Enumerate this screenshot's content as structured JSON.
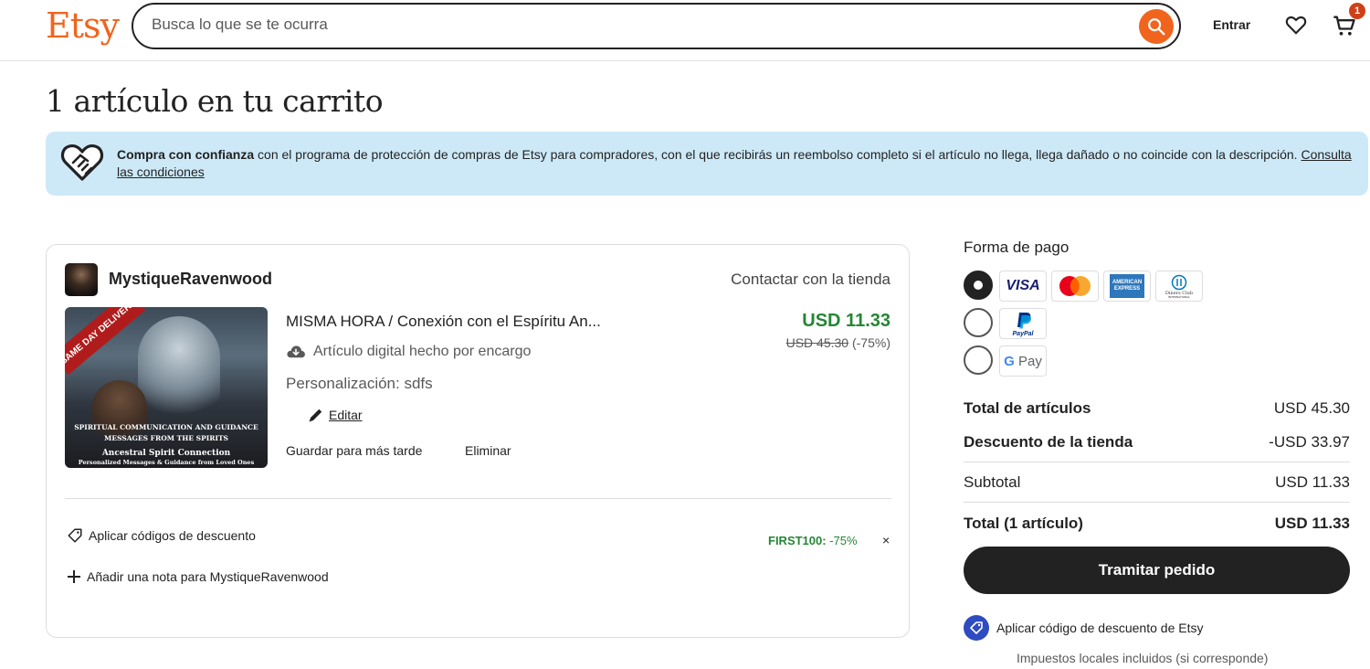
{
  "header": {
    "logo": "Etsy",
    "search_placeholder": "Busca lo que se te ocurra",
    "signin": "Entrar",
    "cart_count": "1"
  },
  "page": {
    "title": "1 artículo en tu carrito"
  },
  "banner": {
    "bold": "Compra con confianza",
    "text": " con el programa de protección de compras de Etsy para compradores, con el que recibirás un reembolso completo si el artículo no llega, llega dañado o no coincide con la descripción. ",
    "link": "Consulta las condiciones"
  },
  "shop": {
    "name": "MystiqueRavenwood",
    "contact": "Contactar con la tienda"
  },
  "item": {
    "image_ribbon": "SAME DAY DELIVERY",
    "image_caption_1": "SPIRITUAL COMMUNICATION AND GUIDANCE",
    "image_caption_2": "MESSAGES FROM THE SPIRITS",
    "image_caption_3": "Ancestral Spirit Connection",
    "image_caption_4": "Personalized Messages & Guidance from Loved Ones",
    "title": "MISMA HORA / Conexión con el Espíritu An...",
    "price": "USD 11.33",
    "original_price": "USD 45.30",
    "discount": "(-75%)",
    "type": "Artículo digital hecho por encargo",
    "personalization": "Personalización: sdfs",
    "edit": "Editar",
    "save_later": "Guardar para más tarde",
    "remove": "Eliminar"
  },
  "card_footer": {
    "apply_codes": "Aplicar códigos de descuento",
    "code_name": "FIRST100:",
    "code_value": " -75%",
    "close": "×",
    "add_note": "Añadir una nota para MystiqueRavenwood"
  },
  "payment": {
    "title": "Forma de pago",
    "methods": [
      "VISA",
      "Mastercard",
      "American Express",
      "Diners Club",
      "PayPal",
      "G Pay"
    ]
  },
  "summary": {
    "items_label": "Total de artículos",
    "items_value": "USD 45.30",
    "discount_label": "Descuento de la tienda",
    "discount_value": "-USD 33.97",
    "subtotal_label": "Subtotal",
    "subtotal_value": "USD 11.33",
    "total_label": "Total (1 artículo)",
    "total_value": "USD 11.33",
    "checkout": "Tramitar pedido",
    "etsy_coupon": "Aplicar código de descuento de Etsy",
    "tax_note": "Impuestos locales incluidos (si corresponde)"
  },
  "colors": {
    "brand": "#f1641e",
    "price_green": "#258635",
    "banner_bg": "#cde9f8",
    "checkout_bg": "#222222"
  }
}
